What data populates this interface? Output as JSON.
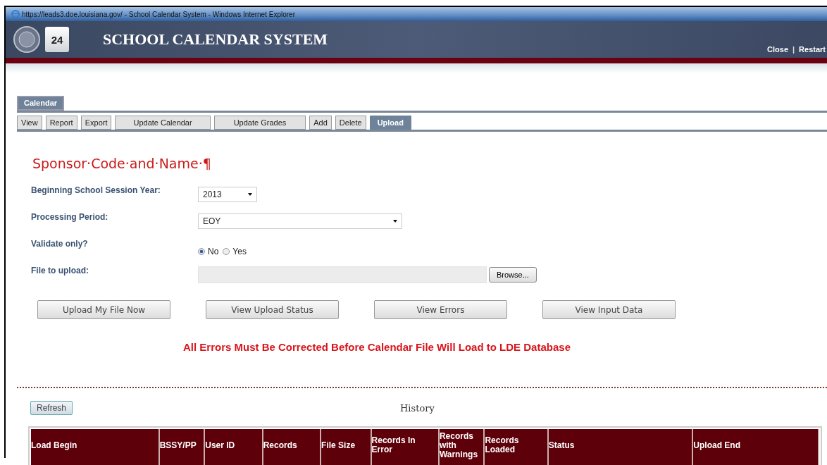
{
  "window": {
    "title": "https://leads3.doe.louisiana.gov/ - School Calendar System  - Windows Internet Explorer"
  },
  "header": {
    "calendar_day": "24",
    "title": "SCHOOL CALENDAR SYSTEM",
    "links": [
      "Close",
      "Restart"
    ],
    "separator": "|"
  },
  "module_tab": {
    "label": "Calendar",
    "selected": true
  },
  "tabs": [
    {
      "label": "View",
      "selected": false
    },
    {
      "label": "Report",
      "selected": false
    },
    {
      "label": "Export",
      "selected": false
    },
    {
      "label": "Update Calendar",
      "selected": false
    },
    {
      "label": "Update Grades",
      "selected": false
    },
    {
      "label": "Add",
      "selected": false
    },
    {
      "label": "Delete",
      "selected": false
    },
    {
      "label": "Upload",
      "selected": true
    }
  ],
  "sponsor_heading": "Sponsor·Code·and·Name·¶",
  "form": {
    "session_year": {
      "label": "Beginning School Session Year:",
      "value": "2013"
    },
    "processing_period": {
      "label": "Processing Period:",
      "value": "EOY"
    },
    "validate_only": {
      "label": "Validate only?",
      "options": [
        {
          "label": "No",
          "selected": true
        },
        {
          "label": "Yes",
          "selected": false
        }
      ]
    },
    "file": {
      "label": "File to upload:",
      "browse": "Browse..."
    }
  },
  "actions": [
    "Upload My File Now",
    "View Upload Status",
    "View Errors",
    "View Input Data"
  ],
  "warning": "All Errors Must Be Corrected Before Calendar File Will Load to LDE Database",
  "history": {
    "refresh": "Refresh",
    "title": "History",
    "columns": [
      "Load Begin",
      "BSSY/PP",
      "User ID",
      "Records",
      "File Size",
      "Records In Error",
      "Records with Warnings",
      "Records Loaded",
      "Status",
      "Upload End"
    ]
  }
}
